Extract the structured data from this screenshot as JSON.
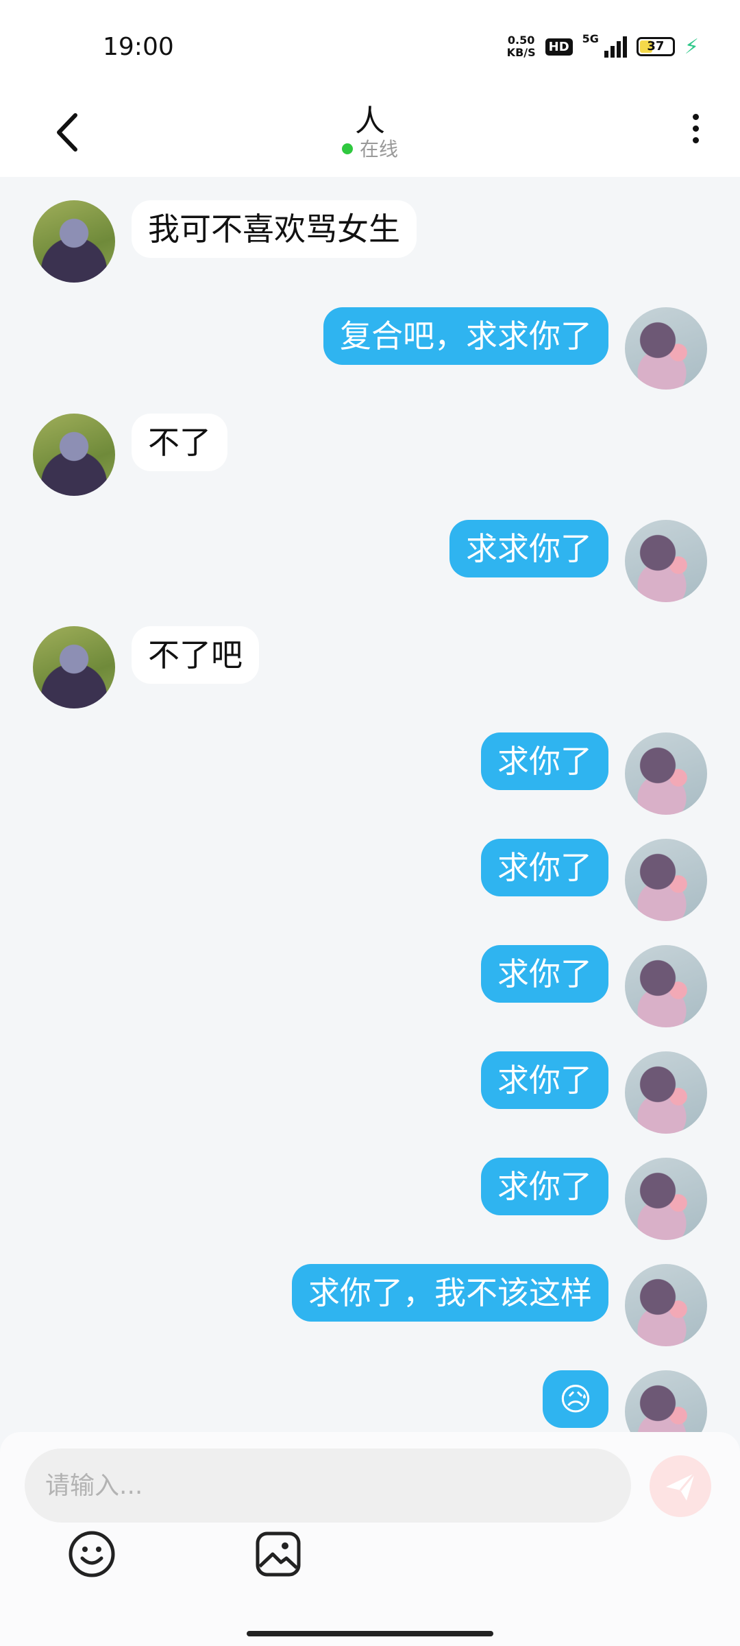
{
  "status_bar": {
    "time": "19:00",
    "net_speed_value": "0.50",
    "net_speed_unit": "KB/S",
    "hd_label": "HD",
    "network_label": "5G",
    "battery_level": "37"
  },
  "header": {
    "title": "人",
    "status": "在线"
  },
  "messages": [
    {
      "side": "left",
      "text": "我可不喜欢骂女生"
    },
    {
      "side": "right",
      "text": "复合吧，求求你了"
    },
    {
      "side": "left",
      "text": "不了"
    },
    {
      "side": "right",
      "text": "求求你了"
    },
    {
      "side": "left",
      "text": "不了吧"
    },
    {
      "side": "right",
      "text": "求你了"
    },
    {
      "side": "right",
      "text": "求你了"
    },
    {
      "side": "right",
      "text": "求你了"
    },
    {
      "side": "right",
      "text": "求你了"
    },
    {
      "side": "right",
      "text": "求你了"
    },
    {
      "side": "right",
      "text": "求你了，我不该这样"
    },
    {
      "side": "right",
      "text": "😥"
    }
  ],
  "composer": {
    "placeholder": "请输入..."
  },
  "icons": {
    "back": "chevron-left-icon",
    "more": "more-vertical-icon",
    "send": "send-icon",
    "emoji": "emoji-icon",
    "image": "image-icon"
  },
  "colors": {
    "outgoing_bubble": "#2fb4f0",
    "incoming_bubble": "#ffffff",
    "online_dot": "#2fc83f",
    "send_button": "#fde3e3"
  }
}
